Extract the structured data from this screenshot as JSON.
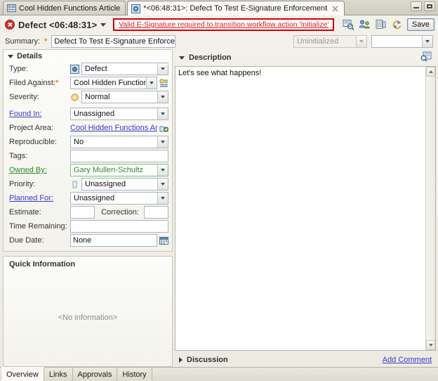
{
  "window": {
    "controls": [
      {
        "name": "minimize",
        "label": "Minimize"
      },
      {
        "name": "maximize",
        "label": "Maximize"
      }
    ]
  },
  "tabs": [
    {
      "label": "Cool Hidden Functions Article",
      "icon": "article-icon",
      "active": false,
      "closable": false
    },
    {
      "label": "*<06:48:31>: Defect To Test E-Signature Enforcement",
      "icon": "defect-icon",
      "active": true,
      "closable": true
    }
  ],
  "header": {
    "status_icon": "error-icon",
    "title": "Defect <06:48:31>",
    "error_message": "Valid E-Signature required to transition workflow action 'Initialize'",
    "error_border_color": "#d40000",
    "error_text_color": "#e01b1b",
    "toolbar": [
      {
        "name": "preview-icon",
        "label": "Preview"
      },
      {
        "name": "team-icon",
        "label": "Team"
      },
      {
        "name": "history-icon",
        "label": "History"
      },
      {
        "name": "refresh-icon",
        "label": "Refresh"
      }
    ],
    "save_label": "Save"
  },
  "summary": {
    "label": "Summary:",
    "required_marker": "*",
    "value": "Defect To Test E-Signature Enforcement",
    "placeholder": "",
    "status": {
      "value": "Uninitialized",
      "disabled": true
    },
    "action": {
      "value": "",
      "placeholder": ""
    }
  },
  "details": {
    "section_title": "Details",
    "expanded": true,
    "fields": [
      {
        "name": "type",
        "label": "Type:",
        "control": "select",
        "value": "Defect",
        "icon": "type-icon",
        "required": false,
        "label_style": "normal"
      },
      {
        "name": "filed-against",
        "label": "Filed Against:",
        "control": "select",
        "value": "Cool Hidden Functions Ar",
        "required": true,
        "side_icon": "category-picker-icon",
        "label_style": "normal"
      },
      {
        "name": "severity",
        "label": "Severity:",
        "control": "select",
        "value": "Normal",
        "icon": "severity-icon",
        "label_style": "normal"
      },
      {
        "name": "found-in",
        "label": "Found In:",
        "control": "select",
        "value": "Unassigned",
        "label_style": "link-blue"
      },
      {
        "name": "project-area",
        "label": "Project Area:",
        "control": "link",
        "value": "Cool Hidden Functions Article",
        "side_icon": "project-area-icon",
        "label_style": "normal"
      },
      {
        "name": "reproducible",
        "label": "Reproducible:",
        "control": "select",
        "value": "No",
        "label_style": "normal"
      },
      {
        "name": "tags",
        "label": "Tags:",
        "control": "text",
        "value": "",
        "label_style": "normal"
      },
      {
        "name": "owned-by",
        "label": "Owned By:",
        "control": "select",
        "value": "Gary Mullen-Schultz",
        "changed": true,
        "label_style": "link-green"
      },
      {
        "name": "priority",
        "label": "Priority:",
        "control": "select",
        "value": "Unassigned",
        "icon": "priority-icon",
        "label_style": "normal"
      },
      {
        "name": "planned-for",
        "label": "Planned For:",
        "control": "select",
        "value": "Unassigned",
        "label_style": "link-blue"
      }
    ],
    "estimate": {
      "label": "Estimate:",
      "value": ""
    },
    "correction": {
      "label": "Correction:",
      "value": ""
    },
    "time_remaining": {
      "label": "Time Remaining:",
      "value": ""
    },
    "due_date": {
      "label": "Due Date:",
      "value": "None",
      "picker_icon": "calendar-icon"
    }
  },
  "quick_information": {
    "title": "Quick Information",
    "empty_text": "<No information>"
  },
  "description": {
    "section_title": "Description",
    "expanded": true,
    "action_icon": "expand-editor-icon",
    "text": "Let's see what happens!"
  },
  "discussion": {
    "section_title": "Discussion",
    "expanded": false,
    "add_comment_label": "Add Comment"
  },
  "bottom_tabs": [
    {
      "label": "Overview",
      "active": true
    },
    {
      "label": "Links",
      "active": false
    },
    {
      "label": "Approvals",
      "active": false
    },
    {
      "label": "History",
      "active": false
    }
  ]
}
